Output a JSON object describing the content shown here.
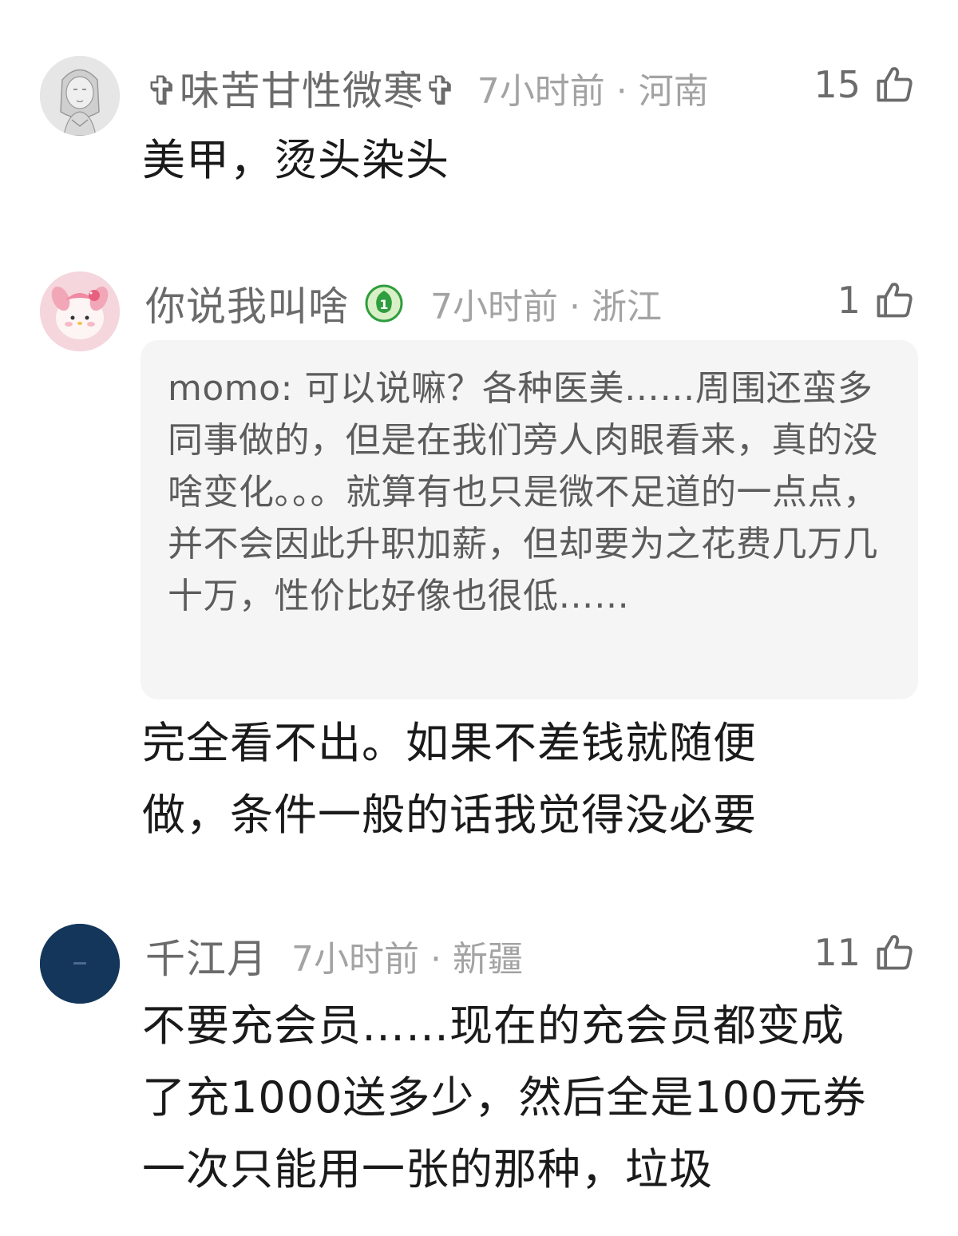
{
  "comments": [
    {
      "username": "✞味苦甘性微寒✞",
      "meta": "7小时前 · 河南",
      "likes": "15",
      "body": "美甲，烫头染头",
      "avatar": "sketch-girl-avatar"
    },
    {
      "username": "你说我叫啥",
      "meta": "7小时前 · 浙江",
      "likes": "1",
      "badge": "level-1-leaf-badge",
      "quote": "momo: 可以说嘛？各种医美……周围还蛮多同事做的，但是在我们旁人肉眼看来，真的没啥变化。。。就算有也只是微不足道的一点点，并不会因此升职加薪，但却要为之花费几万几十万，性价比好像也很低……",
      "body": "完全看不出。如果不差钱就随便做，条件一般的话我觉得没必要",
      "avatar": "pink-plush-avatar"
    },
    {
      "username": "千江月",
      "meta": "7小时前 · 新疆",
      "likes": "11",
      "body": "不要充会员……现在的充会员都变成了充1000送多少，然后全是100元券一次只能用一张的那种，垃圾",
      "avatar": "navy-circle-avatar"
    }
  ],
  "colors": {
    "username": "#6b6b6b",
    "meta": "#a3a3a3",
    "body": "#1a1a1a",
    "quote_bg": "#f5f5f5",
    "quote_text": "#5c5c5c",
    "badge_green": "#2e9e3e",
    "avatar_navy": "#14365a"
  },
  "icons": {
    "like": "thumbs-up-icon"
  }
}
